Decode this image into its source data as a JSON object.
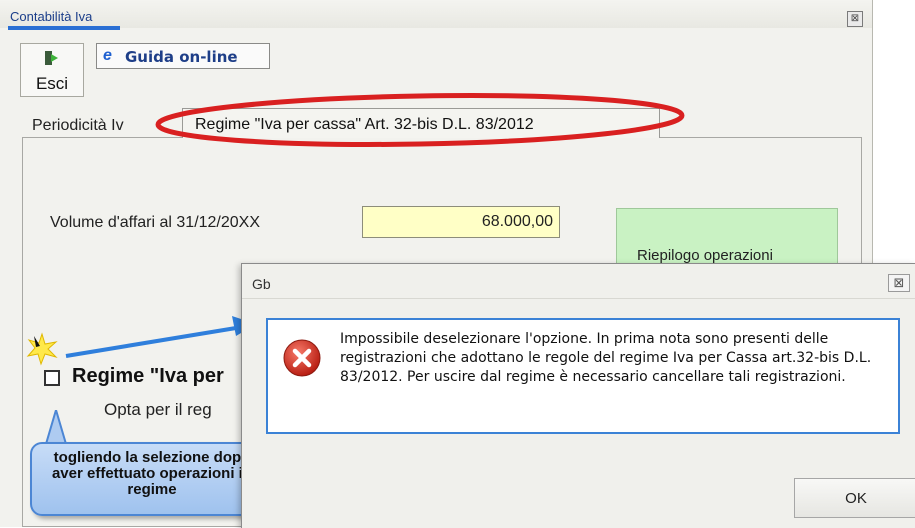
{
  "window": {
    "title": "Contabilità Iva",
    "close_glyph": "⊠"
  },
  "toolbar": {
    "esci_label": "Esci",
    "esci_icon": "exit-door-icon",
    "guida_label": "Guida on-line",
    "guida_icon": "internet-explorer-icon"
  },
  "tabs": [
    {
      "label": "Periodicità Iv"
    },
    {
      "label": "Regime \"Iva per cassa\" Art. 32-bis D.L. 83/2012",
      "selected": true
    }
  ],
  "panel": {
    "volume_label": "Volume d'affari al 31/12/20XX",
    "volume_value": "68.000,00",
    "riepilogo_label": "Riepilogo operazioni",
    "regime_checkbox_label": "Regime \"Iva per",
    "regime_checked": false,
    "opta_label": "Opta per il reg"
  },
  "callout": {
    "text": "togliendo la selezione dopo aver effettuato operazioni in regime"
  },
  "dialog": {
    "title": "Gb",
    "close_glyph": "⊠",
    "icon": "error-icon",
    "message": "Impossibile deselezionare l'opzione. In prima nota sono presenti delle registrazioni che adottano le regole del regime Iva per Cassa art.32-bis D.L. 83/2012. Per uscire dal regime è necessario cancellare tali registrazioni.",
    "ok_label": "OK"
  },
  "colors": {
    "highlight_ellipse": "#d92020",
    "arrow": "#2f7fdc",
    "volume_field": "#ffffc6",
    "riepilogo_bg": "#c9f2c3"
  }
}
